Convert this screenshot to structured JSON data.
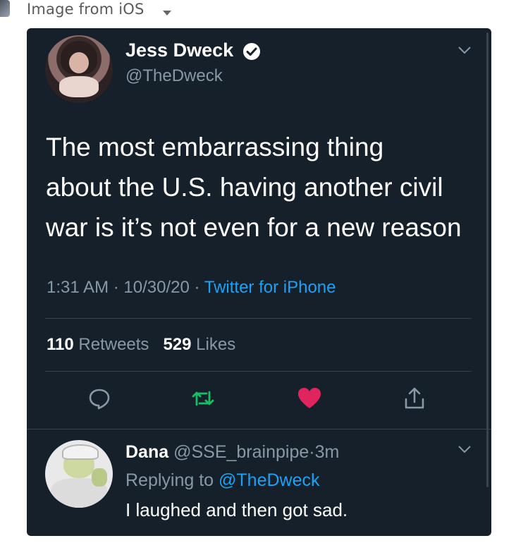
{
  "header": {
    "title": "Image from iOS",
    "avatar_icon": "user-avatar-icon",
    "caret_icon": "caret-down-icon"
  },
  "tweet": {
    "author_name": "Jess Dweck",
    "handle": "@TheDweck",
    "verified": true,
    "text_lines": [
      "The most embarrassing thing",
      "about the U.S. having another civil",
      "war is it’s not even for a new reason"
    ],
    "time": "1:31 AM",
    "date": "10/30/20",
    "separator": "·",
    "source": "Twitter for iPhone",
    "retweets_count": "110",
    "retweets_label": "Retweets",
    "likes_count": "529",
    "likes_label": "Likes"
  },
  "reply": {
    "author_name": "Dana",
    "handle": "@SSE_brainpipe",
    "separator": "·",
    "time": "3m",
    "replying_prefix": "Replying to",
    "replying_to": "@TheDweck",
    "text": "I laughed and then got sad."
  },
  "colors": {
    "card_background": "#15202b",
    "text_primary": "#ffffff",
    "text_secondary": "#8899a6",
    "accent_blue": "#1da1f2",
    "retweet_green": "#17bf63",
    "like_pink": "#e0245e",
    "divider": "#38444d"
  }
}
